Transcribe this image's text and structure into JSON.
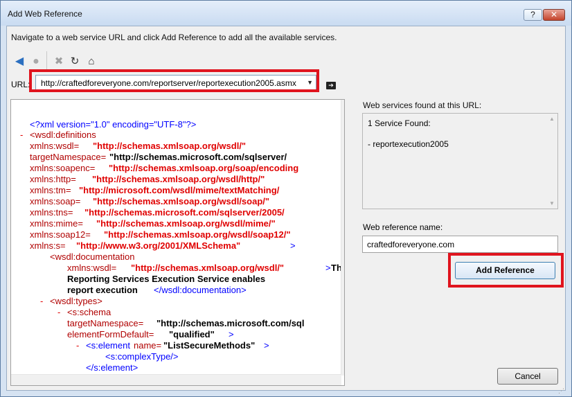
{
  "window": {
    "title": "Add Web Reference",
    "help_label": "?",
    "close_label": "✕"
  },
  "instruction": "Navigate to a web service URL and click Add Reference to add all the available services.",
  "toolbar": {
    "icons": [
      "back-icon",
      "stop-icon",
      "cancel-icon",
      "refresh-icon",
      "home-icon"
    ]
  },
  "url": {
    "label": "URL:",
    "value": "http://craftedforeveryone.com/reportserver/reportexecution2005.asmx",
    "go_icon": "go-arrow-icon"
  },
  "xml": {
    "l1": "<?xml version=\"1.0\" encoding=\"UTF-8\"?>",
    "l2_minus": "-",
    "l2": "<wsdl:definitions",
    "l3_name": "xmlns:wsdl=",
    "l3_val": "\"http://schemas.xmlsoap.org/wsdl/\"",
    "l4_name": "targetNamespace=",
    "l4_val": "\"http://schemas.microsoft.com/sqlserver/",
    "l5_name": "xmlns:soapenc=",
    "l5_val": "\"http://schemas.xmlsoap.org/soap/encoding",
    "l6_name": "xmlns:http=",
    "l6_val": "\"http://schemas.xmlsoap.org/wsdl/http/\"",
    "l7_name": "xmlns:tm=",
    "l7_val": "\"http://microsoft.com/wsdl/mime/textMatching/",
    "l8_name": "xmlns:soap=",
    "l8_val": "\"http://schemas.xmlsoap.org/wsdl/soap/\"",
    "l9_name": "xmlns:tns=",
    "l9_val": "\"http://schemas.microsoft.com/sqlserver/2005/",
    "l10_name": "xmlns:mime=",
    "l10_val": "\"http://schemas.xmlsoap.org/wsdl/mime/\"",
    "l11_name": "xmlns:soap12=",
    "l11_val": "\"http://schemas.xmlsoap.org/wsdl/soap12/\"",
    "l12_name": "xmlns:s=",
    "l12_val": "\"http://www.w3.org/2001/XMLSchema\"",
    "l12_end": ">",
    "l13": "<wsdl:documentation",
    "l14_name": "xmlns:wsdl=",
    "l14_val": "\"http://schemas.xmlsoap.org/wsdl/\"",
    "l14_end": ">",
    "l14_text": "Th",
    "l15": "Reporting Services Execution Service enables",
    "l16_text": "report execution",
    "l16_end": "</wsdl:documentation>",
    "l17_minus": "-",
    "l17": "<wsdl:types>",
    "l18_minus": "-",
    "l18": "<s:schema",
    "l19_name": "targetNamespace=",
    "l19_val": "\"http://schemas.microsoft.com/sql",
    "l20_name": "elementFormDefault=",
    "l20_val": "\"qualified\"",
    "l20_end": ">",
    "l21_minus": "-",
    "l21_tag": "<s:element",
    "l21_name": " name=",
    "l21_val": "\"ListSecureMethods\"",
    "l21_end": ">",
    "l22": "<s:complexType/>",
    "l23": "</s:element>"
  },
  "services": {
    "label": "Web services found at this URL:",
    "count": "1 Service Found:",
    "item": "- reportexecution2005"
  },
  "reference": {
    "label": "Web reference name:",
    "value": "craftedforeveryone.com"
  },
  "buttons": {
    "add_reference": "Add Reference",
    "cancel": "Cancel"
  },
  "highlight_color": "#e0141e"
}
